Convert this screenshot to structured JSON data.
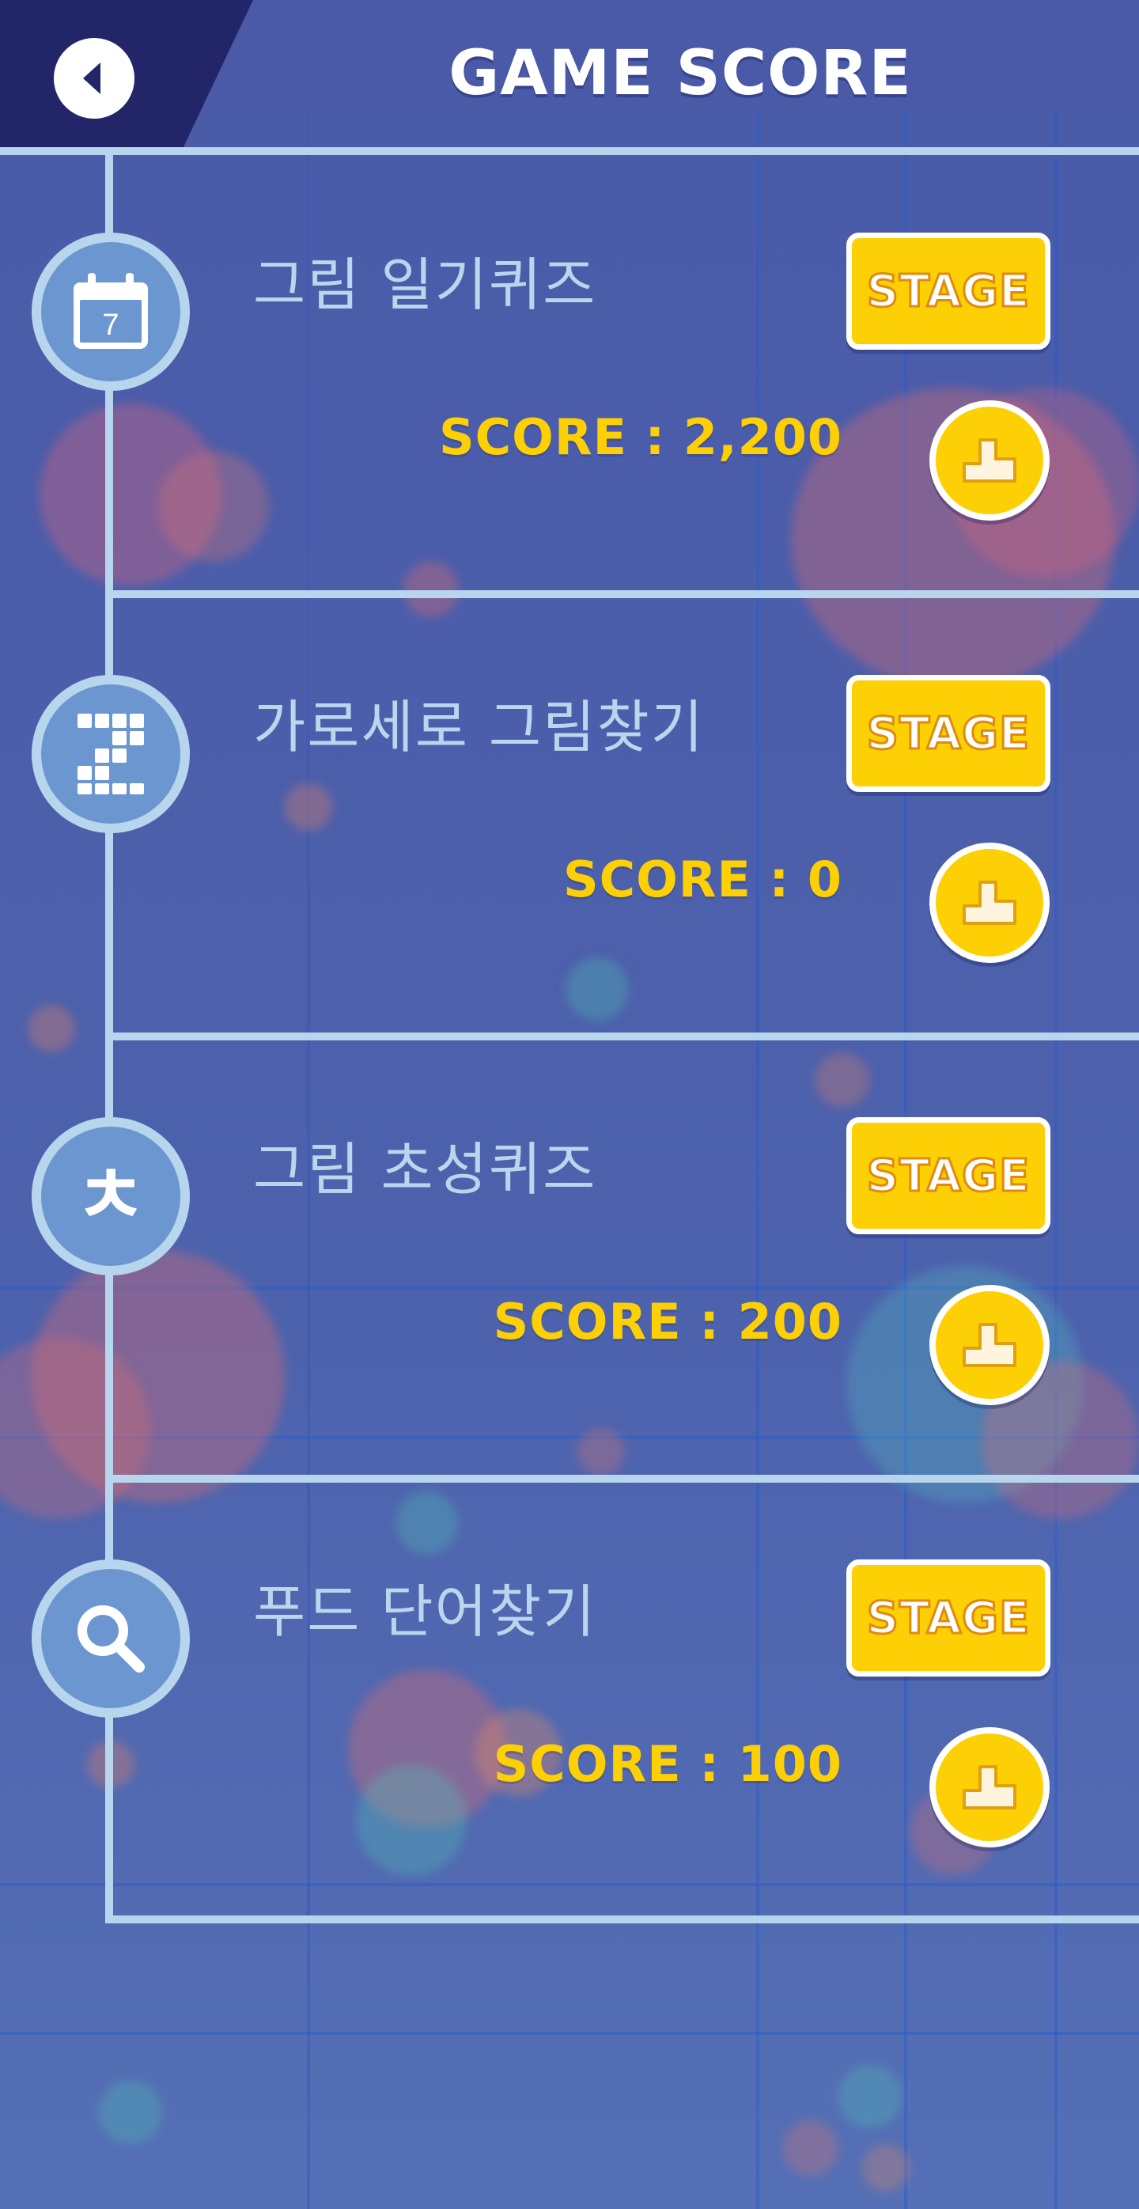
{
  "header": {
    "title": "GAME SCORE",
    "back_icon": "back-arrow-icon"
  },
  "games": [
    {
      "title": "그림 일기퀴즈",
      "icon": "calendar-icon",
      "icon_text": "7",
      "stage_label": "STAGE",
      "score_text": "SCORE : 2,200",
      "score": 2200,
      "rank_icon": "podium-icon"
    },
    {
      "title": "가로세로 그림찾기",
      "icon": "crossword-grid-icon",
      "stage_label": "STAGE",
      "score_text": "SCORE : 0",
      "score": 0,
      "rank_icon": "podium-icon"
    },
    {
      "title": "그림 초성퀴즈",
      "icon": "hangul-initial-icon",
      "icon_text": "ㅊ",
      "stage_label": "STAGE",
      "score_text": "SCORE : 200",
      "score": 200,
      "rank_icon": "podium-icon"
    },
    {
      "title": "푸드 단어찾기",
      "icon": "magnifier-icon",
      "stage_label": "STAGE",
      "score_text": "SCORE : 100",
      "score": 100,
      "rank_icon": "podium-icon"
    }
  ],
  "colors": {
    "background": "#4a5aa8",
    "header_corner": "#222668",
    "line": "#b7d5ec",
    "icon_fill": "#6b96d0",
    "title_text": "#b9d6ec",
    "accent_yellow": "#fcd005",
    "stage_outline": "#e08a10"
  }
}
